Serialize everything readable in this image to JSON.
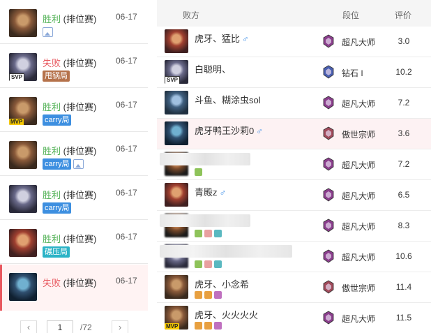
{
  "matches": [
    {
      "result": "胜利",
      "type": "(排位赛)",
      "date": "06-17",
      "tags": [],
      "photo": true,
      "badge": "",
      "win": true
    },
    {
      "result": "失败",
      "type": "(排位赛)",
      "date": "06-17",
      "tags": [
        {
          "label": "甩锅局",
          "color": "#b5724b"
        }
      ],
      "photo": false,
      "badge": "SVP",
      "win": false
    },
    {
      "result": "胜利",
      "type": "(排位赛)",
      "date": "06-17",
      "tags": [
        {
          "label": "carry局",
          "color": "#3d8fe0"
        }
      ],
      "photo": false,
      "badge": "MVP",
      "win": true
    },
    {
      "result": "胜利",
      "type": "(排位赛)",
      "date": "06-17",
      "tags": [
        {
          "label": "carry局",
          "color": "#3d8fe0"
        }
      ],
      "photo": true,
      "badge": "",
      "win": true
    },
    {
      "result": "胜利",
      "type": "(排位赛)",
      "date": "06-17",
      "tags": [
        {
          "label": "carry局",
          "color": "#3d8fe0"
        }
      ],
      "photo": false,
      "badge": "",
      "win": true
    },
    {
      "result": "胜利",
      "type": "(排位赛)",
      "date": "06-17",
      "tags": [
        {
          "label": "碾压局",
          "color": "#2bb3c6"
        }
      ],
      "photo": false,
      "badge": "",
      "win": true
    },
    {
      "result": "失败",
      "type": "(排位赛)",
      "date": "06-17",
      "tags": [],
      "photo": false,
      "badge": "",
      "win": false
    }
  ],
  "pagination": {
    "prev": "‹",
    "page": "1",
    "total": "/72",
    "next": "›"
  },
  "table": {
    "headers": {
      "team": "败方",
      "rank": "段位",
      "score": "评价"
    },
    "rows": [
      {
        "name": "虎牙、猛比",
        "male": true,
        "rank": "超凡大师",
        "score": "3.0",
        "blurred": false,
        "rank_color": "#8a3e8c"
      },
      {
        "name": "白聪明、",
        "male": false,
        "rank": "钻石 I",
        "score": "10.2",
        "blurred": false,
        "rank_color": "#4a5fb0",
        "badge": "SVP"
      },
      {
        "name": "斗鱼、糊涂虫sol",
        "male": false,
        "rank": "超凡大师",
        "score": "7.2",
        "blurred": false,
        "rank_color": "#8a3e8c"
      },
      {
        "name": "虎牙鸭王沙莉0",
        "male": true,
        "rank": "傲世宗师",
        "score": "3.6",
        "blurred": false,
        "rank_color": "#a04a5a",
        "highlight": true
      },
      {
        "name": "",
        "male": false,
        "rank": "超凡大师",
        "score": "7.2",
        "blurred": true,
        "rank_color": "#8a3e8c"
      },
      {
        "name": "青殿z",
        "male": true,
        "rank": "超凡大师",
        "score": "6.5",
        "blurred": false,
        "rank_color": "#8a3e8c"
      },
      {
        "name": "",
        "male": false,
        "rank": "超凡大师",
        "score": "8.3",
        "blurred": true,
        "rank_color": "#8a3e8c"
      },
      {
        "name": "",
        "male": false,
        "rank": "超凡大师",
        "score": "10.6",
        "blurred": true,
        "rank_color": "#8a3e8c"
      },
      {
        "name": "虎牙、小念希",
        "male": false,
        "rank": "傲世宗师",
        "score": "11.4",
        "blurred": false,
        "rank_color": "#a04a5a"
      },
      {
        "name": "虎牙、火火火火",
        "male": false,
        "rank": "超凡大师",
        "score": "11.5",
        "blurred": false,
        "rank_color": "#8a3e8c",
        "badge": "MVP"
      }
    ]
  },
  "icons": {
    "male": "♂",
    "photo": "photo-icon"
  }
}
